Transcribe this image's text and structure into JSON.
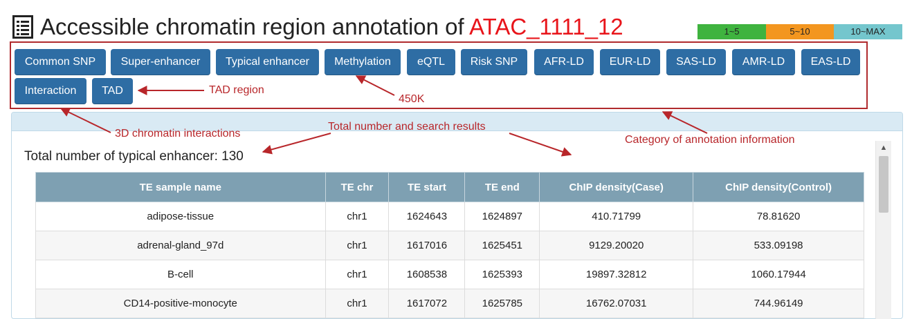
{
  "page": {
    "title_prefix": "Accessible chromatin region annotation of",
    "title_id": "ATAC_1111_12",
    "title_icon": "list-icon"
  },
  "legend": [
    {
      "label": "1~5",
      "color": "#3fb33f"
    },
    {
      "label": "5~10",
      "color": "#f3961f"
    },
    {
      "label": "10~MAX",
      "color": "#74c6cd"
    }
  ],
  "categories": [
    "Common SNP",
    "Super-enhancer",
    "Typical enhancer",
    "Methylation",
    "eQTL",
    "Risk SNP",
    "AFR-LD",
    "EUR-LD",
    "SAS-LD",
    "AMR-LD",
    "EAS-LD",
    "Interaction",
    "TAD"
  ],
  "total_label": "Total number of typical enhancer: 130",
  "table": {
    "headers": [
      "TE sample name",
      "TE chr",
      "TE start",
      "TE end",
      "ChIP density(Case)",
      "ChIP density(Control)"
    ],
    "rows": [
      [
        "adipose-tissue",
        "chr1",
        "1624643",
        "1624897",
        "410.71799",
        "78.81620"
      ],
      [
        "adrenal-gland_97d",
        "chr1",
        "1617016",
        "1625451",
        "9129.20020",
        "533.09198"
      ],
      [
        "B-cell",
        "chr1",
        "1608538",
        "1625393",
        "19897.32812",
        "1060.17944"
      ],
      [
        "CD14-positive-monocyte",
        "chr1",
        "1617072",
        "1625785",
        "16762.07031",
        "744.96149"
      ]
    ]
  },
  "annotations": {
    "tad_region": "TAD region",
    "k450": "450K",
    "interactions": "3D chromatin interactions",
    "total_results": "Total number and search results",
    "category": "Category of annotation information"
  },
  "scrollbar": {
    "up_icon": "chevron-up-icon"
  }
}
